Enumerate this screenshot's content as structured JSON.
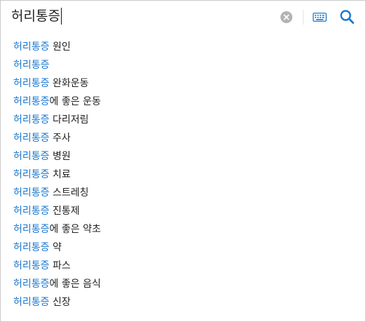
{
  "search": {
    "query": "허리통증",
    "clear_icon": "clear-circle-x-icon",
    "keyboard_icon": "keyboard-icon",
    "search_icon": "magnifier-icon"
  },
  "colors": {
    "highlight": "#1a78d0",
    "text": "#222222",
    "border": "#c9c9c9",
    "icon_gray": "#b3b3b3",
    "search_blue": "#1a78d0"
  },
  "suggestions": [
    {
      "highlight": "허리통증",
      "rest": " 원인"
    },
    {
      "highlight": "허리통증",
      "rest": ""
    },
    {
      "highlight": "허리통증",
      "rest": " 완화운동"
    },
    {
      "highlight": "허리통증",
      "rest": "에 좋은 운동"
    },
    {
      "highlight": "허리통증",
      "rest": " 다리저림"
    },
    {
      "highlight": "허리통증",
      "rest": " 주사"
    },
    {
      "highlight": "허리통증",
      "rest": " 병원"
    },
    {
      "highlight": "허리통증",
      "rest": " 치료"
    },
    {
      "highlight": "허리통증",
      "rest": " 스트레칭"
    },
    {
      "highlight": "허리통증",
      "rest": " 진통제"
    },
    {
      "highlight": "허리통증",
      "rest": "에 좋은 약초"
    },
    {
      "highlight": "허리통증",
      "rest": " 약"
    },
    {
      "highlight": "허리통증",
      "rest": " 파스"
    },
    {
      "highlight": "허리통증",
      "rest": "에 좋은 음식"
    },
    {
      "highlight": "허리통증",
      "rest": " 신장"
    }
  ]
}
